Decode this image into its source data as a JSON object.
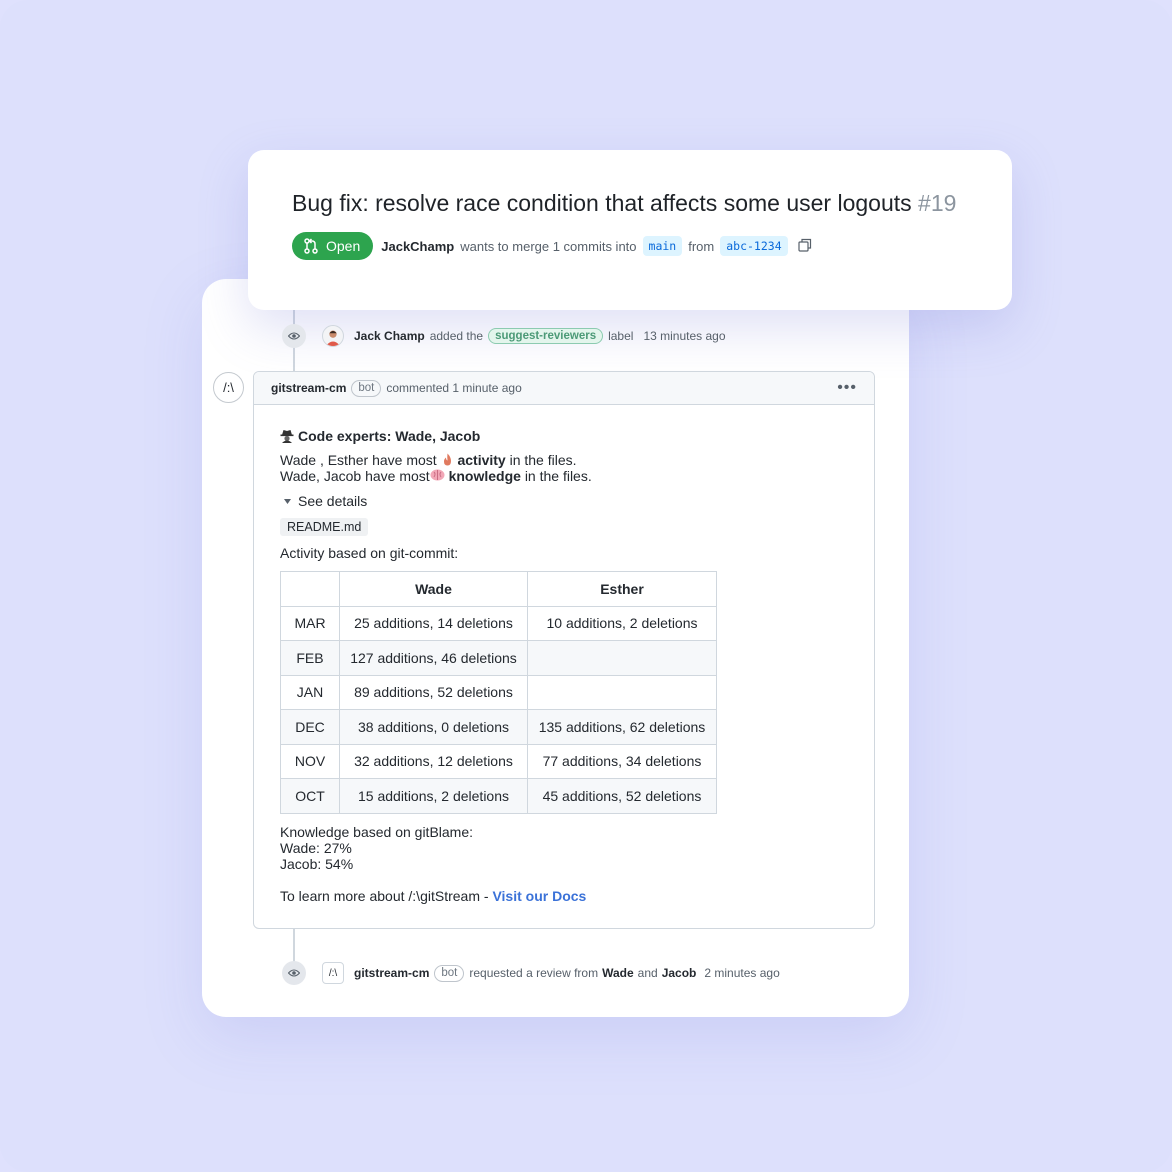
{
  "pr": {
    "title": "Bug fix: resolve race condition that affects some user logouts",
    "number": "#19",
    "status": "Open",
    "author": "JackChamp",
    "merge_text": "wants to merge 1 commits into",
    "base_branch": "main",
    "from_text": "from",
    "head_branch": "abc-1234"
  },
  "label_event": {
    "user": "Jack Champ",
    "text_before": "added the",
    "label": "suggest-reviewers",
    "text_after": "label",
    "time": "13 minutes ago"
  },
  "comment": {
    "avatar_text": "/:\\",
    "author": "gitstream-cm",
    "badge": "bot",
    "action": "commented 1 minute ago",
    "heading": "Code experts: Wade, Jacob",
    "activity_line": {
      "pre": "Wade , Esther have most",
      "bold": "activity",
      "post": "in the files."
    },
    "knowledge_line": {
      "pre": "Wade, Jacob have most",
      "bold": "knowledge",
      "post": "in the files."
    },
    "details_label": "See details",
    "file": "README.md",
    "activity_title": "Activity based on git-commit:",
    "table": {
      "headers": [
        "",
        "Wade",
        "Esther"
      ],
      "rows": [
        [
          "MAR",
          "25 additions, 14 deletions",
          "10 additions, 2 deletions"
        ],
        [
          "FEB",
          "127 additions, 46 deletions",
          ""
        ],
        [
          "JAN",
          "89 additions, 52 deletions",
          ""
        ],
        [
          "DEC",
          "38 additions, 0 deletions",
          "135 additions, 62 deletions"
        ],
        [
          "NOV",
          "32 additions, 12 deletions",
          "77 additions, 34 deletions"
        ],
        [
          "OCT",
          "15 additions, 2 deletions",
          "45 additions, 52 deletions"
        ]
      ]
    },
    "knowledge_title": "Knowledge based on gitBlame:",
    "knowledge_values": [
      "Wade: 27%",
      "Jacob: 54%"
    ],
    "learn_text": "To learn more about /:\\gitStream -",
    "docs_link": "Visit our Docs"
  },
  "review_event": {
    "avatar_text": "/:\\",
    "user": "gitstream-cm",
    "badge": "bot",
    "text": "requested a review from",
    "reviewer1": "Wade",
    "and_text": "and",
    "reviewer2": "Jacob",
    "time": "2 minutes ago"
  },
  "colors": {
    "background": "#dfe1fd",
    "open_badge": "#2da44e",
    "branch_bg": "#ddf4ff",
    "branch_text": "#0969da",
    "label_border": "#8ccbb0",
    "link": "#3b72d8"
  },
  "icons": [
    "git-pull-request-icon",
    "copy-icon",
    "eye-icon",
    "user-avatar-icon",
    "kebab-menu-icon",
    "detective-icon",
    "fire-icon",
    "brain-icon",
    "triangle-down-icon"
  ]
}
